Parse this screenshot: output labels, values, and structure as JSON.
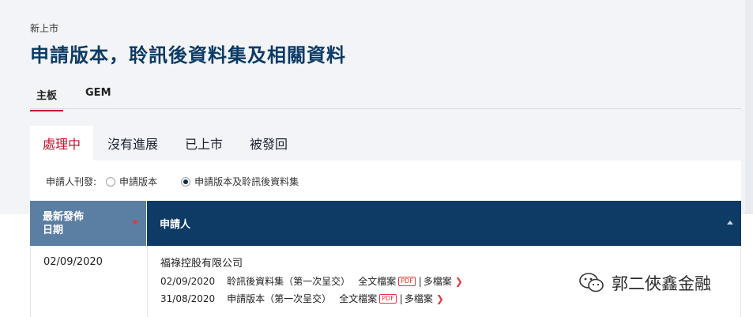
{
  "breadcrumb": "新上市",
  "page_title": "申請版本，聆訊後資料集及相關資料",
  "market_tabs": [
    {
      "label": "主板",
      "active": true
    },
    {
      "label": "GEM",
      "active": false
    }
  ],
  "status_tabs": [
    {
      "label": "處理中",
      "active": true
    },
    {
      "label": "沒有進展",
      "active": false
    },
    {
      "label": "已上市",
      "active": false
    },
    {
      "label": "被發回",
      "active": false
    }
  ],
  "filter": {
    "label": "申請人刊發:",
    "options": [
      {
        "label": "申請版本",
        "checked": false
      },
      {
        "label": "申請版本及聆訊後資料集",
        "checked": true
      }
    ]
  },
  "table": {
    "headers": {
      "date_line1": "最新發佈",
      "date_line2": "日期",
      "applicant": "申請人"
    },
    "rows": [
      {
        "date": "02/09/2020",
        "company": "福祿控股有限公司",
        "documents": [
          {
            "date": "02/09/2020",
            "type": "聆訊後資料集（第一次呈交）",
            "full_text": "全文檔案",
            "badge": "PDF",
            "separator": "|",
            "more": "多檔案"
          },
          {
            "date": "31/08/2020",
            "type": "申請版本（第一次呈交）",
            "full_text": "全文檔案",
            "badge": "PDF",
            "separator": "|",
            "more": "多檔案"
          }
        ]
      }
    ]
  },
  "watermark": {
    "text": "郭二俠鑫金融",
    "icon": "wechat-icon"
  },
  "colors": {
    "brand_navy": "#0d3b66",
    "accent_red": "#c8102e",
    "header_blue": "#5b7ea3"
  }
}
